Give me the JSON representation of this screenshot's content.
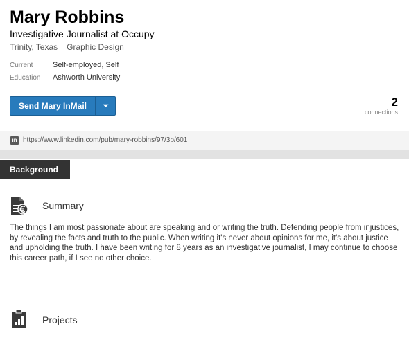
{
  "profile": {
    "name": "Mary Robbins",
    "headline": "Investigative Journalist at Occupy",
    "location": "Trinity, Texas",
    "industry": "Graphic Design",
    "facts": [
      {
        "label": "Current",
        "value": "Self-employed, Self"
      },
      {
        "label": "Education",
        "value": "Ashworth University"
      }
    ],
    "inmail_button": "Send Mary InMail",
    "connections_count": "2",
    "connections_label": "connections",
    "public_url": "https://www.linkedin.com/pub/mary-robbins/97/3b/601",
    "url_icon": "in"
  },
  "background": {
    "tab_label": "Background",
    "summary": {
      "title": "Summary",
      "icon": "summary-icon",
      "text": "The things I am most passionate about are speaking and or writing the truth. Defending people from injustices, by revealing the facts and truth to the public. When writing it's never about opinions for me, it's about justice and upholding the truth. I have been writing for 8 years as an investigative journalist, I may continue to choose this career path, if I see no other choice."
    },
    "projects": {
      "title": "Projects",
      "icon": "projects-icon"
    }
  },
  "colors": {
    "button_blue": "#287bbc",
    "tab_dark": "#333333"
  }
}
